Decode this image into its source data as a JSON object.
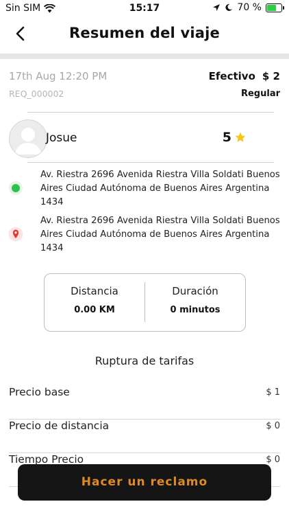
{
  "status_bar": {
    "carrier": "Sin SIM",
    "time": "15:17",
    "battery": "70 %",
    "battery_level_percent": 70
  },
  "header": {
    "title": "Resumen del viaje"
  },
  "trip": {
    "date": "17th Aug 12:20 PM",
    "request_id": "REQ_000002",
    "payment_method": "Efectivo",
    "payment_amount": "$ 2",
    "service_type": "Regular"
  },
  "driver": {
    "name": "Josue",
    "rating": "5"
  },
  "pickup": {
    "address": "Av. Riestra 2696 Avenida Riestra Villa Soldati Buenos Aires Ciudad Autónoma de Buenos Aires Argentina 1434"
  },
  "dropoff": {
    "address": "Av. Riestra 2696 Avenida Riestra Villa Soldati Buenos Aires Ciudad Autónoma de Buenos Aires Argentina 1434"
  },
  "stats": {
    "distance_label": "Distancia",
    "distance_value": "0.00 KM",
    "duration_label": "Duración",
    "duration_value": "0 minutos"
  },
  "fares": {
    "title": "Ruptura de tarifas",
    "items": [
      {
        "label": "Precio base",
        "value": "$ 1"
      },
      {
        "label": "Precio de distancia",
        "value": "$ 0"
      },
      {
        "label": "Tiempo Precio",
        "value": "$ 0"
      }
    ]
  },
  "claim_button": {
    "label": "Hacer un reclamo"
  },
  "colors": {
    "accent_text": "#e08a26",
    "button_bg": "#151515",
    "pickup_green": "#2fbf4a",
    "dropoff_red": "#e53935",
    "star_yellow": "#f5c518"
  }
}
